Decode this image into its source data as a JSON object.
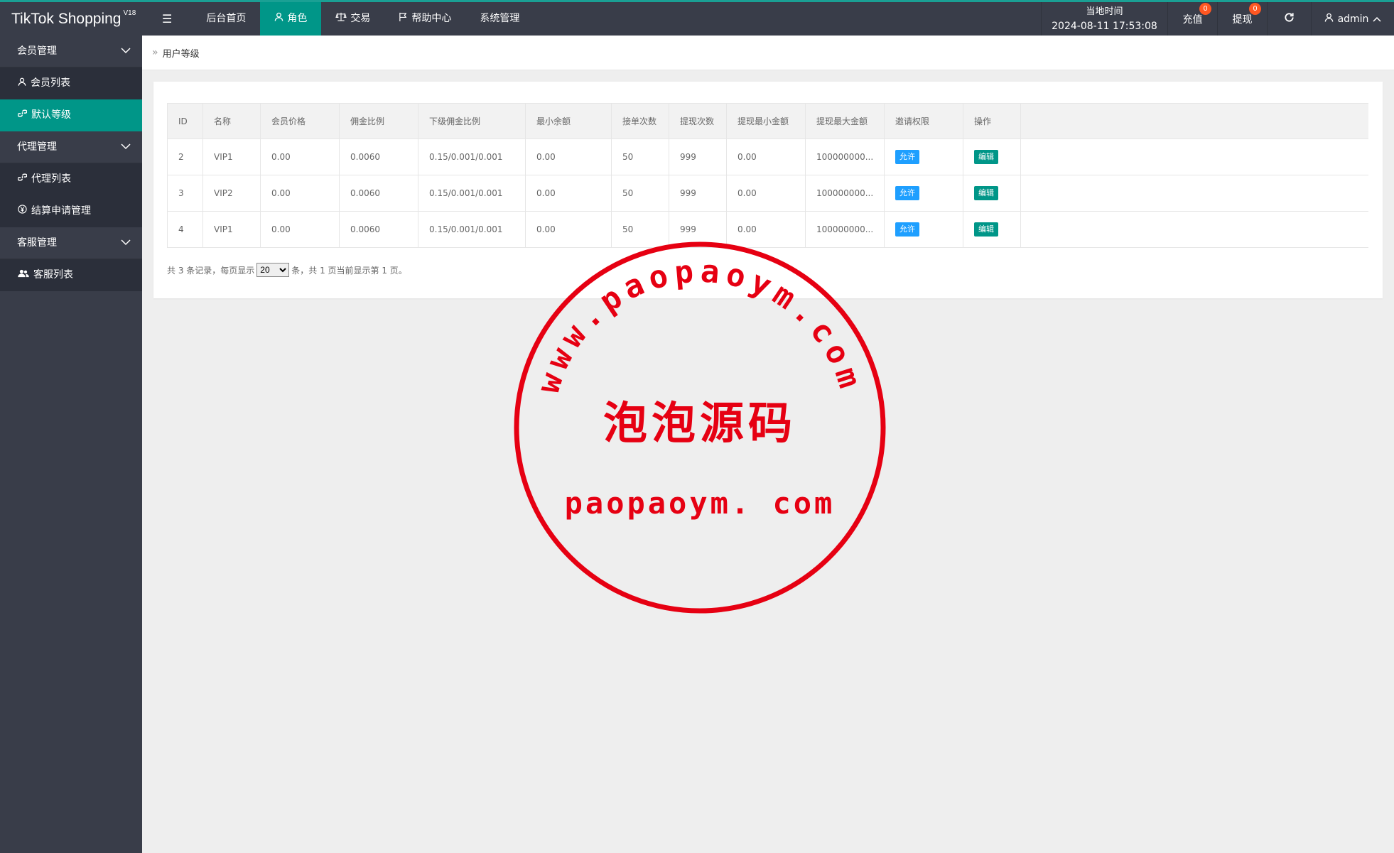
{
  "header": {
    "logo": "TikTok Shopping",
    "logo_version": "V18",
    "nav": [
      {
        "label": "后台首页",
        "active": false
      },
      {
        "label": "角色",
        "active": true
      },
      {
        "label": "交易",
        "active": false
      },
      {
        "label": "帮助中心",
        "active": false
      },
      {
        "label": "系统管理",
        "active": false
      }
    ],
    "time_label": "当地时间",
    "time_value": "2024-08-11 17:53:08",
    "recharge_label": "充值",
    "recharge_badge": "0",
    "withdraw_label": "提现",
    "withdraw_badge": "0",
    "user_label": "admin"
  },
  "sidebar": {
    "groups": [
      {
        "label": "会员管理",
        "items": [
          {
            "label": "会员列表",
            "icon": "user-icon"
          },
          {
            "label": "默认等级",
            "icon": "link-icon",
            "active": true
          }
        ]
      },
      {
        "label": "代理管理",
        "items": [
          {
            "label": "代理列表",
            "icon": "link-icon"
          },
          {
            "label": "结算申请管理",
            "icon": "yen-icon"
          }
        ]
      },
      {
        "label": "客服管理",
        "items": [
          {
            "label": "客服列表",
            "icon": "users-icon"
          }
        ]
      }
    ]
  },
  "breadcrumb": {
    "current": "用户等级"
  },
  "table": {
    "columns": [
      "ID",
      "名称",
      "会员价格",
      "佣金比例",
      "下级佣金比例",
      "最小余额",
      "接单次数",
      "提现次数",
      "提现最小金额",
      "提现最大金额",
      "邀请权限",
      "操作"
    ],
    "rows": [
      {
        "id": "2",
        "name": "VIP1",
        "price": "0.00",
        "rate": "0.0060",
        "sub_rate": "0.15/0.001/0.001",
        "min_balance": "0.00",
        "orders": "50",
        "withdraw_times": "999",
        "withdraw_min": "0.00",
        "withdraw_max": "100000000...",
        "invite": "允许",
        "action": "编辑"
      },
      {
        "id": "3",
        "name": "VIP2",
        "price": "0.00",
        "rate": "0.0060",
        "sub_rate": "0.15/0.001/0.001",
        "min_balance": "0.00",
        "orders": "50",
        "withdraw_times": "999",
        "withdraw_min": "0.00",
        "withdraw_max": "100000000...",
        "invite": "允许",
        "action": "编辑"
      },
      {
        "id": "4",
        "name": "VIP1",
        "price": "0.00",
        "rate": "0.0060",
        "sub_rate": "0.15/0.001/0.001",
        "min_balance": "0.00",
        "orders": "50",
        "withdraw_times": "999",
        "withdraw_min": "0.00",
        "withdraw_max": "100000000...",
        "invite": "允许",
        "action": "编辑"
      }
    ]
  },
  "pager": {
    "prefix": "共 3 条记录，每页显示",
    "page_size": "20",
    "suffix": "条，共 1 页当前显示第 1 页。"
  },
  "watermark": {
    "top_text": "www.paopaoym.com",
    "center_text": "泡泡源码",
    "bottom_text": "paopaoym. com",
    "color": "#e60012"
  },
  "colors": {
    "header_bg": "#393d49",
    "accent": "#009688",
    "allow_tag": "#1e9fff",
    "badge": "#ff5722"
  }
}
